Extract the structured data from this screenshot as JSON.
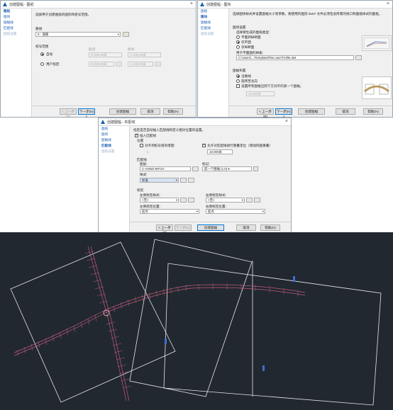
{
  "common": {
    "back": "< 上一步(B)",
    "next": "下一步(N) >",
    "create": "创建图幅",
    "cancel": "取消",
    "help": "帮助(H)"
  },
  "dialog1": {
    "title": "创建图幅 - 图纸",
    "nav": [
      "图纸",
      "图块",
      "图幅线",
      "匹配线",
      "图纸设置"
    ],
    "intro": "选择用于创建图纸的图形和桩号范围。",
    "alignment_label": "路线",
    "alignment_value": "0 - 道路",
    "station_group": "桩号范围",
    "auto_label": "自动",
    "user_label": "用户指定:",
    "start_label": "起点:",
    "end_label": "终点:",
    "start_value": "0+000.00米",
    "end_value": "1+400.00米",
    "start_dis": "0+000.00米",
    "end_dis": "1+400.00米"
  },
  "dialog2": {
    "title": "创建图幅 - 图块",
    "nav": [
      "图纸",
      "图块",
      "图幅线",
      "匹配线",
      "图纸设置"
    ],
    "intro": "选择图块样式并设置图幅大小等参数，要使用的图形 DWT 文件必须包含所需的视口和图纸样式的图框。",
    "layout_group": "图块设置",
    "sheets_label": "选择要生成的图纸类型:",
    "opt1": "平面到纵断面",
    "opt2": "仅平面",
    "opt3": "仅纵断面",
    "template_label": "用于平面图的样板:",
    "template_value": "C:\\Users\\...\\Template\\Plan and Profile.dwt",
    "placement_group": "图幅布置",
    "place1": "沿路线",
    "place2": "旋转至北向",
    "place3": "设置所有图幅沿到下方对齐的第一个图幅。",
    "overlap_value": "10.000米"
  },
  "dialog3": {
    "title": "创建图幅 - 匹配线",
    "nav": [
      "图纸",
      "图块",
      "图幅线",
      "匹配线",
      "图纸设置"
    ],
    "intro": "指定是否自动插入匹配线和定义相对位置的设置。",
    "insert_label": "插入匹配线",
    "pos_group": "位置",
    "snap_label": "对齐到桩号值的增量:",
    "snap_value": "1",
    "allow_label": "允许对匹配线进行重叠定位（增加同图重叠）",
    "overlap_value": "10.000米",
    "ml_group": "匹配线",
    "layer_label": "图层:",
    "layer_value": "C-ANNO-MTCH",
    "style_label": "样式:",
    "style_value": "标准",
    "mark_label": "标记:",
    "mark_value": "前一个图幅 (1.0) ▾",
    "tag_group": "标签",
    "left_style": "左侧标签样式:",
    "right_style": "右侧标签样式:",
    "left_pos": "左侧标签位置:",
    "right_pos": "右侧标签位置:",
    "none": "<无>",
    "start_pos": "起点",
    "end_pos": "起点"
  },
  "cad": {
    "ruler_color": "#f0f0f0",
    "road_color": "#c05a78",
    "frame_color": "#e8e8e8"
  }
}
